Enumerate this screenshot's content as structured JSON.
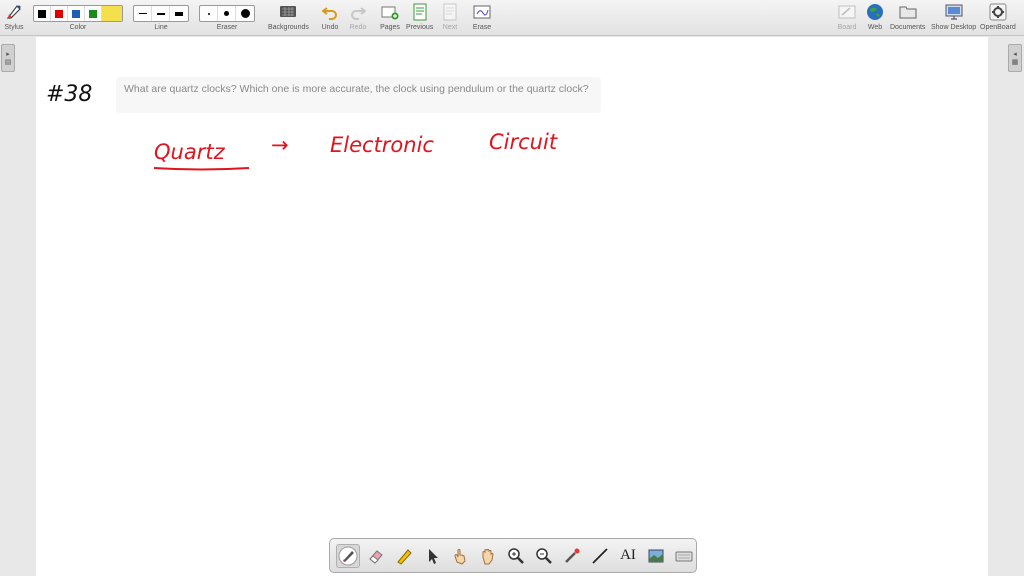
{
  "toolbar": {
    "stylus": "Stylus",
    "color": "Color",
    "line": "Line",
    "eraser": "Eraser",
    "backgrounds": "Backgrounds",
    "undo": "Undo",
    "redo": "Redo",
    "pages": "Pages",
    "previous": "Previous",
    "next": "Next",
    "erase": "Erase",
    "board": "Board",
    "web": "Web",
    "documents": "Documents",
    "show_desktop": "Show Desktop",
    "openboard": "OpenBoard",
    "colors": [
      "#000000",
      "#e00000",
      "#1e5fb4",
      "#1a8a1a",
      "#f4e04d"
    ]
  },
  "board": {
    "question_number": "#38",
    "question_text": "What are quartz clocks? Which one is more accurate, the clock using pendulum or the quartz clock?",
    "handwritten": {
      "word1": "Quartz",
      "arrow": "→",
      "word2": "Electronic",
      "word3": "Circuit",
      "ink_color": "#e0141e"
    }
  },
  "bottom_toolbar": {
    "tools": [
      "pen-icon",
      "eraser-icon",
      "marker-icon",
      "pointer-icon",
      "laser-hand-icon",
      "hand-icon",
      "zoom-in-icon",
      "zoom-out-icon",
      "laser-pointer-icon",
      "line-icon",
      "text-icon",
      "capture-icon",
      "keyboard-icon"
    ],
    "text_tool_label": "AI"
  }
}
